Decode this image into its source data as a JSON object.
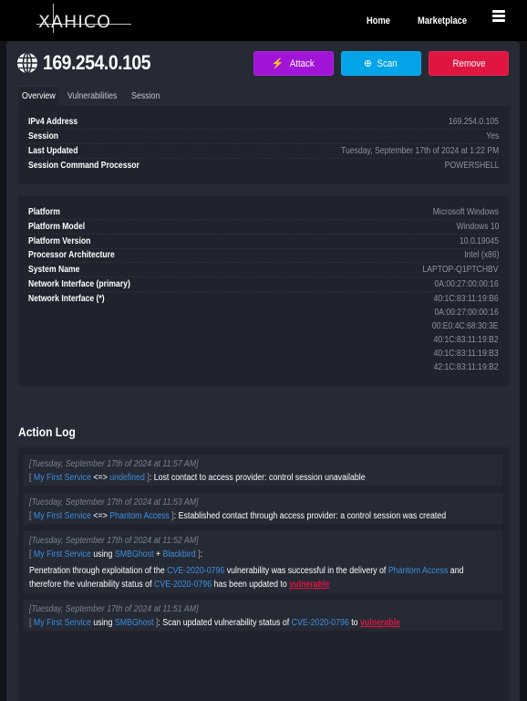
{
  "nav": {
    "brand": "XAHICO",
    "links": [
      {
        "label": "Home"
      },
      {
        "label": "Marketplace"
      }
    ],
    "menu_icon": "hamburger-menu-icon"
  },
  "host": {
    "icon": "globe-icon",
    "ip": "169.254.0.105",
    "actions": {
      "attack": {
        "label": "Attack",
        "icon": "lightning-icon",
        "color": "#a215d8"
      },
      "scan": {
        "label": "Scan",
        "icon": "crosshair-icon",
        "color": "#03a4e8"
      },
      "remove": {
        "label": "Remove",
        "color": "#e01540"
      }
    }
  },
  "tabs": [
    {
      "label": "Overview",
      "active": true
    },
    {
      "label": "Vulnerabilities",
      "active": false
    },
    {
      "label": "Session",
      "active": false
    }
  ],
  "overview": {
    "general": [
      {
        "key": "IPv4 Address",
        "value": "169.254.0.105"
      },
      {
        "key": "Session",
        "value": "Yes"
      },
      {
        "key": "Last Updated",
        "value": "Tuesday, September 17th of 2024 at 1:22 PM"
      },
      {
        "key": "Session Command Processor",
        "value": "POWERSHELL"
      }
    ],
    "system": [
      {
        "key": "Platform",
        "value": "Microsoft Windows"
      },
      {
        "key": "Platform Model",
        "value": "Windows 10"
      },
      {
        "key": "Platform Version",
        "value": "10.0.19045"
      },
      {
        "key": "Processor Architecture",
        "value": "Intel (x86)"
      },
      {
        "key": "System Name",
        "value": "LAPTOP-Q1PTCHBV"
      },
      {
        "key": "Network Interface (primary)",
        "value": "0A:00:27:00:00:16"
      },
      {
        "key": "Network Interface (*)",
        "value": "40:1C:83:11:19:B6"
      }
    ],
    "extra_interfaces": [
      "0A:00:27:00:00:16",
      "00:E0:4C:68:30:3E",
      "40:1C:83:11:19:B2",
      "40:1C:83:11:19:B3",
      "42:1C:83:11:19:B2"
    ]
  },
  "action_log": {
    "title": "Action Log",
    "entries": [
      {
        "timestamp": "[Tuesday, September 17th of 2024 at 11:57 AM]",
        "source": "My First Service",
        "connector": "<=>",
        "target": "undefined",
        "message": "Lost contact to access provider: control session unavailable"
      },
      {
        "timestamp": "[Tuesday, September 17th of 2024 at 11:53 AM]",
        "source": "My First Service",
        "connector": "<=>",
        "target": "Phantom Access",
        "message": "Established contact through access provider: a control session was created"
      },
      {
        "timestamp": "[Tuesday, September 17th of 2024 at 11:52 AM]",
        "source": "My First Service",
        "using": "using",
        "tool": "SMBGhost",
        "plus": "+",
        "payload": "Blackbird",
        "msg_part1": "Penetration through exploitation of the",
        "cve": "CVE-2020-0796",
        "msg_part2": "vulnerability was successful in the delivery of",
        "delivered": "Phantom Access",
        "msg_part3": "and therefore the vulnerability status of",
        "msg_part4": "has been updated to",
        "status": "vulnerable"
      },
      {
        "timestamp": "[Tuesday, September 17th of 2024 at 11:51 AM]",
        "source": "My First Service",
        "using": "using",
        "tool": "SMBGhost",
        "msg_part1": "Scan updated vulnerability status of",
        "cve": "CVE-2020-0796",
        "msg_part2": "to",
        "status": "vulnerable"
      }
    ]
  }
}
